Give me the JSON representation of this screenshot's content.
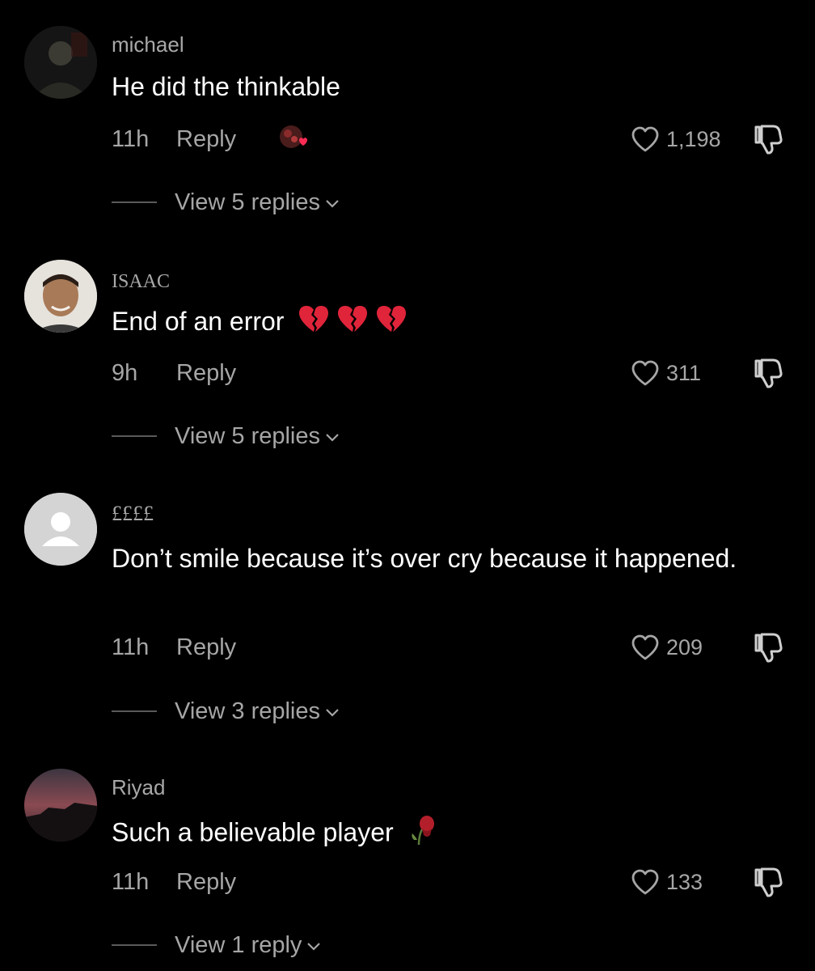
{
  "comments": [
    {
      "username": "michael",
      "text": "He did the thinkable",
      "time": "11h",
      "reply_label": "Reply",
      "likes": "1,198",
      "view_replies": "View 5 replies",
      "emoji": [],
      "liked_by_creator_icon": "heart-badge-avatar-icon"
    },
    {
      "username": "ISAAC",
      "text": "End of an error",
      "time": "9h",
      "reply_label": "Reply",
      "likes": "311",
      "view_replies": "View 5 replies",
      "emoji": [
        "broken-heart-emoji",
        "broken-heart-emoji",
        "broken-heart-emoji"
      ]
    },
    {
      "username": "££££",
      "text": "Don’t smile because it’s over cry because it happened.",
      "time": "11h",
      "reply_label": "Reply",
      "likes": "209",
      "view_replies": "View 3 replies",
      "emoji": []
    },
    {
      "username": "Riyad",
      "text": "Such a believable player",
      "time": "11h",
      "reply_label": "Reply",
      "likes": "133",
      "view_replies": "View 1 reply",
      "emoji": [
        "wilted-rose-emoji"
      ]
    }
  ],
  "colors": {
    "background": "#000000",
    "text_primary": "#ffffff",
    "text_secondary": "#a6a6a6",
    "broken_heart": "#e0243a",
    "creator_heart": "#fe2c55"
  }
}
